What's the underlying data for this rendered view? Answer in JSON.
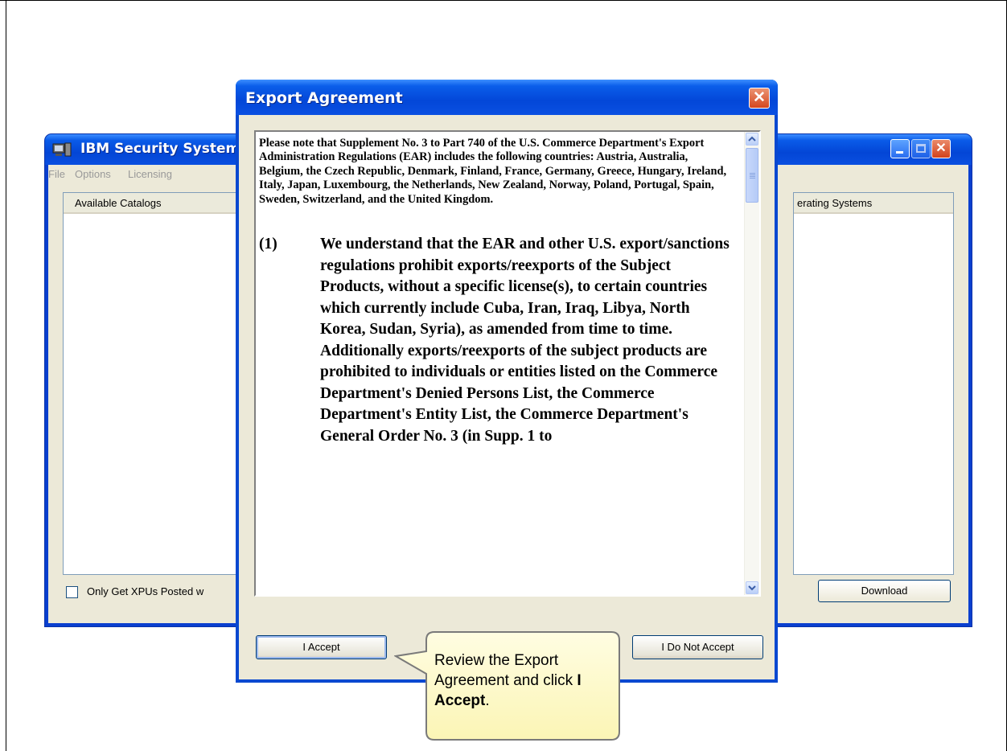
{
  "main_window": {
    "title": "IBM Security Systems",
    "menu": [
      "File",
      "Options",
      "Licensing"
    ],
    "catalog_header": "Available Catalogs",
    "os_header": "erating Systems",
    "checkbox_label": "Only Get XPUs Posted w",
    "download_label": "Download"
  },
  "dialog": {
    "title": "Export Agreement",
    "notice": "Please note that Supplement No. 3 to Part 740 of the U.S. Commerce Department's Export Administration Regulations (EAR) includes the following countries:  Austria, Australia, Belgium, the Czech Republic, Denmark, Finland, France, Germany, Greece, Hungary, Ireland, Italy, Japan, Luxembourg, the Netherlands, New Zealand, Norway, Poland, Portugal, Spain, Sweden, Switzerland, and the United Kingdom.",
    "clause_number": "(1)",
    "clause_text": "We understand that the EAR and other U.S. export/sanctions regulations prohibit exports/reexports of the Subject Products, without a specific license(s), to certain countries which currently include Cuba, Iran, Iraq, Libya, North Korea, Sudan, Syria), as amended from time to time. Additionally exports/reexports of the subject products are prohibited to individuals or entities listed on the Commerce Department's Denied Persons List, the Commerce Department's Entity List, the Commerce Department's General Order No. 3 (in Supp. 1 to",
    "accept_label": "I Accept",
    "decline_label": "I Do Not Accept"
  },
  "callout": {
    "text_before": "Review the Export Agreement and click ",
    "text_bold": "I Accept",
    "text_after": "."
  }
}
